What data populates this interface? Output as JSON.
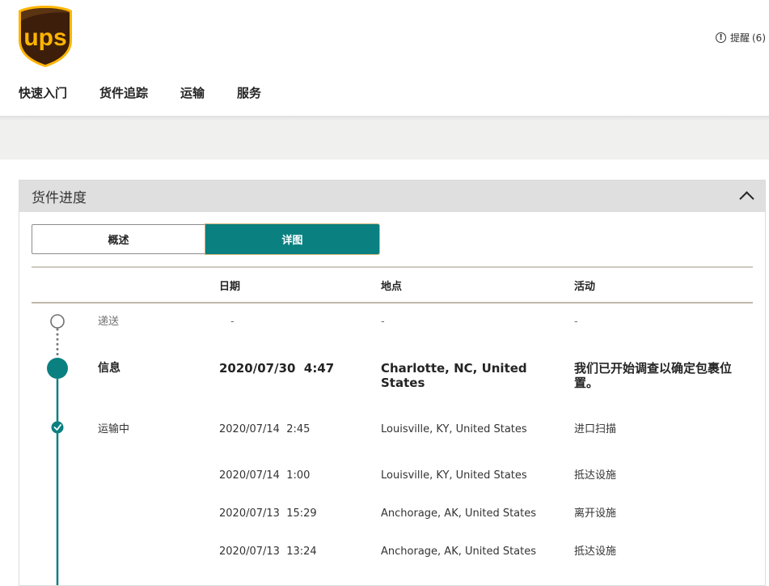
{
  "header": {
    "logo_text": "ups",
    "alerts_label": "提醒",
    "alerts_count": "(6)",
    "nav": [
      "快速入门",
      "货件追踪",
      "运输",
      "服务"
    ]
  },
  "panel": {
    "title": "货件进度",
    "tabs": {
      "summary": "概述",
      "detail": "详图"
    },
    "columns": {
      "date": "日期",
      "location": "地点",
      "activity": "活动"
    },
    "milestones": [
      {
        "label": "递送",
        "date": "-",
        "location": "-",
        "activity": "-"
      },
      {
        "label": "信息",
        "date": "2020/07/30  4:47",
        "location": "Charlotte, NC, United States",
        "activity": "我们已开始调查以确定包裹位置。"
      },
      {
        "label": "运输中",
        "date": "2020/07/14  2:45",
        "location": "Louisville, KY, United States",
        "activity": "进口扫描"
      }
    ],
    "events": [
      {
        "date": "2020/07/14  1:00",
        "location": "Louisville, KY, United States",
        "activity": "抵达设施"
      },
      {
        "date": "2020/07/13  15:29",
        "location": "Anchorage, AK, United States",
        "activity": "离开设施"
      },
      {
        "date": "2020/07/13  13:24",
        "location": "Anchorage, AK, United States",
        "activity": "抵达设施"
      }
    ]
  },
  "colors": {
    "brand_brown": "#3c1e0a",
    "brand_gold": "#ffb500",
    "teal": "#0a8080"
  }
}
